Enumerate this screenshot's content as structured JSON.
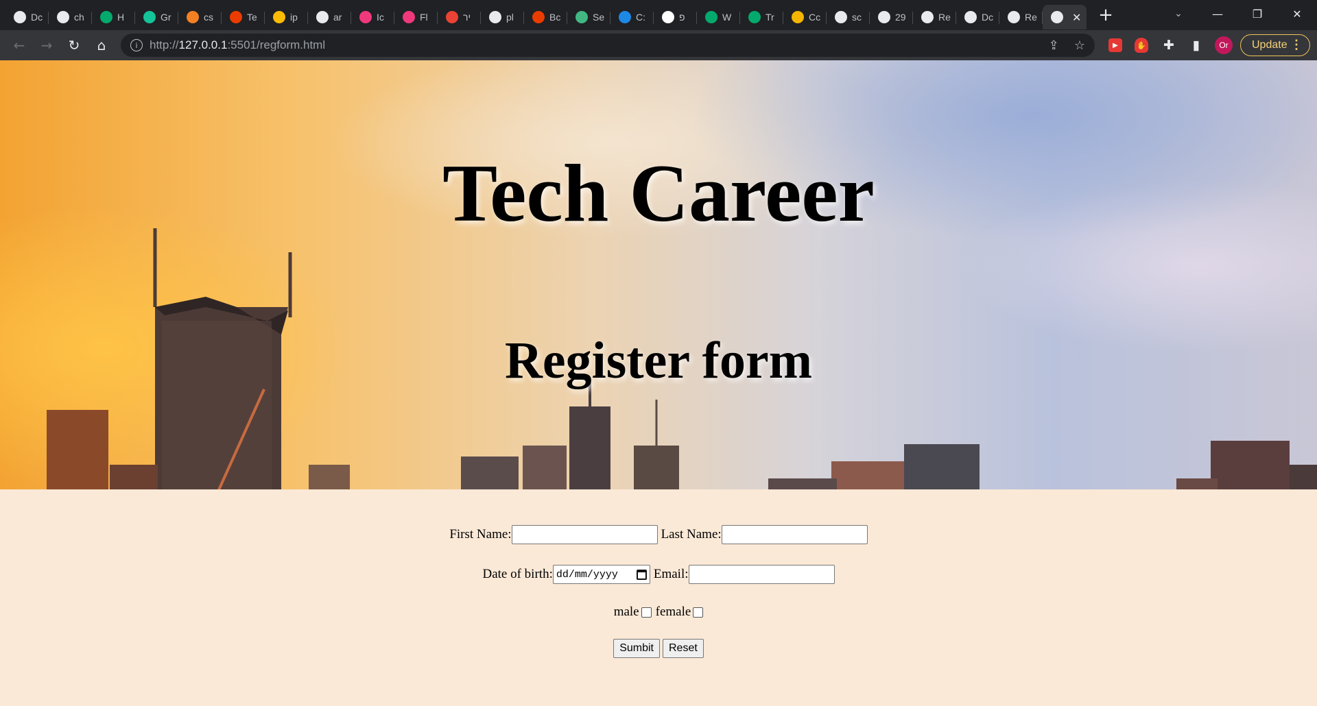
{
  "browser": {
    "tabs": [
      {
        "label": "Dc",
        "icon": "globe-icon",
        "color": "#e8eaed"
      },
      {
        "label": "ch",
        "icon": "google-icon",
        "color": "#e8eaed"
      },
      {
        "label": "H",
        "icon": "w3schools-icon",
        "color": "#04aa6d"
      },
      {
        "label": "Gr",
        "icon": "grammarly-icon",
        "color": "#15c39a"
      },
      {
        "label": "cs",
        "icon": "stackoverflow-icon",
        "color": "#f48024"
      },
      {
        "label": "Te",
        "icon": "office-icon",
        "color": "#eb3c00"
      },
      {
        "label": "ip",
        "icon": "google-drive-icon",
        "color": "#fbbc04"
      },
      {
        "label": "ar",
        "icon": "google-icon",
        "color": "#e8eaed"
      },
      {
        "label": "Ic",
        "icon": "bird-icon",
        "color": "#f0397c"
      },
      {
        "label": "Fl",
        "icon": "bird-icon",
        "color": "#f0397c"
      },
      {
        "label": "יר",
        "icon": "gmail-icon",
        "color": "#ea4335"
      },
      {
        "label": "pl",
        "icon": "google-icon",
        "color": "#e8eaed"
      },
      {
        "label": "Bc",
        "icon": "office-icon",
        "color": "#eb3c00"
      },
      {
        "label": "Se",
        "icon": "vue-icon",
        "color": "#41b883"
      },
      {
        "label": "C:",
        "icon": "edge-icon",
        "color": "#1e88e5"
      },
      {
        "label": "פ",
        "icon": "wikipedia-icon",
        "color": "#ffffff"
      },
      {
        "label": "W",
        "icon": "w3schools-icon",
        "color": "#04aa6d"
      },
      {
        "label": "Tr",
        "icon": "w3schools-icon",
        "color": "#04aa6d"
      },
      {
        "label": "Cc",
        "icon": "extension-icon",
        "color": "#f4b400"
      },
      {
        "label": "sc",
        "icon": "google-icon",
        "color": "#e8eaed"
      },
      {
        "label": "29",
        "icon": "github-icon",
        "color": "#e8eaed"
      },
      {
        "label": "Re",
        "icon": "globe-icon",
        "color": "#e8eaed"
      },
      {
        "label": "Dc",
        "icon": "globe-icon",
        "color": "#e8eaed"
      },
      {
        "label": "Re",
        "icon": "globe-icon",
        "color": "#e8eaed"
      }
    ],
    "active_tab_icon": "globe-icon",
    "new_tab": "+",
    "window_controls": {
      "minimize": "—",
      "restore": "❐",
      "close": "✕"
    },
    "url_prefix": "http://",
    "url_host": "127.0.0.1",
    "url_rest": ":5501/regform.html",
    "profile_initials": "Or",
    "update_label": "Update",
    "accent_update": "#f0c45a"
  },
  "page": {
    "title": "Tech Career",
    "subtitle": "Register form",
    "form": {
      "first_name_label": "First Name:",
      "last_name_label": "Last Name:",
      "dob_label": "Date of birth:",
      "dob_placeholder": "dd/mm/yyyy",
      "email_label": "Email:",
      "male_label": "male",
      "female_label": "female",
      "submit_label": "Sumbit",
      "reset_label": "Reset"
    },
    "background_color": "#fbe9d7"
  }
}
